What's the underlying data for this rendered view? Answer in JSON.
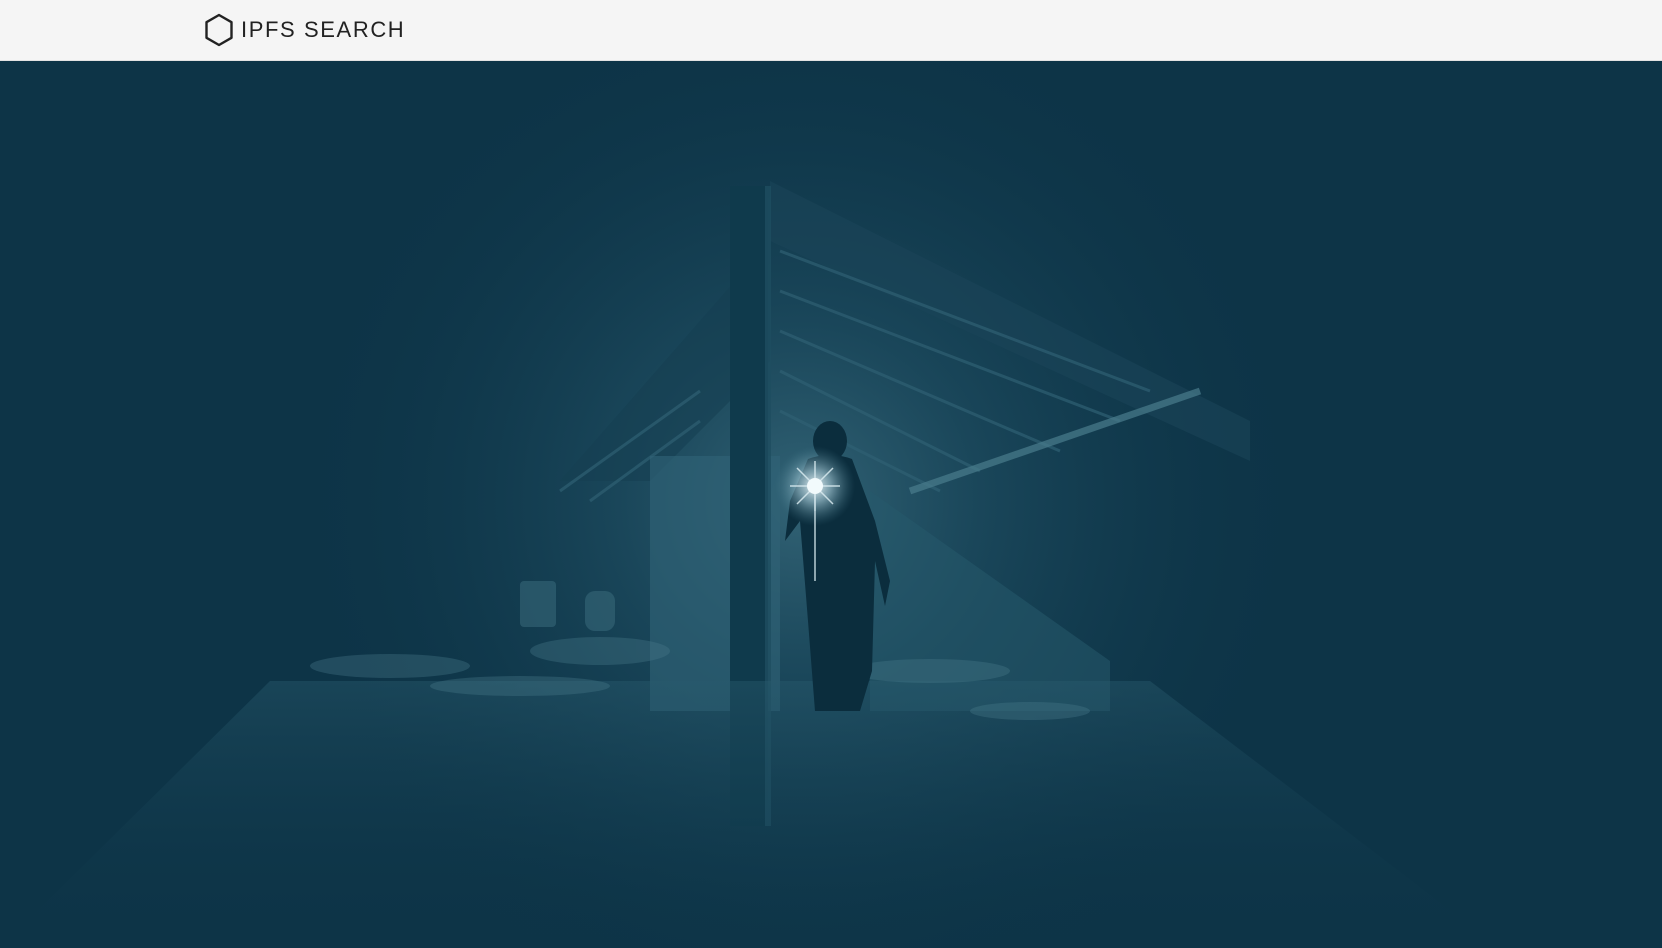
{
  "header": {
    "brand_name": "IPFS SEARCH",
    "brand_icon": "hexagon-icon"
  },
  "hero": {
    "image": "hero-background-image",
    "tint_color": "#0d3447"
  }
}
